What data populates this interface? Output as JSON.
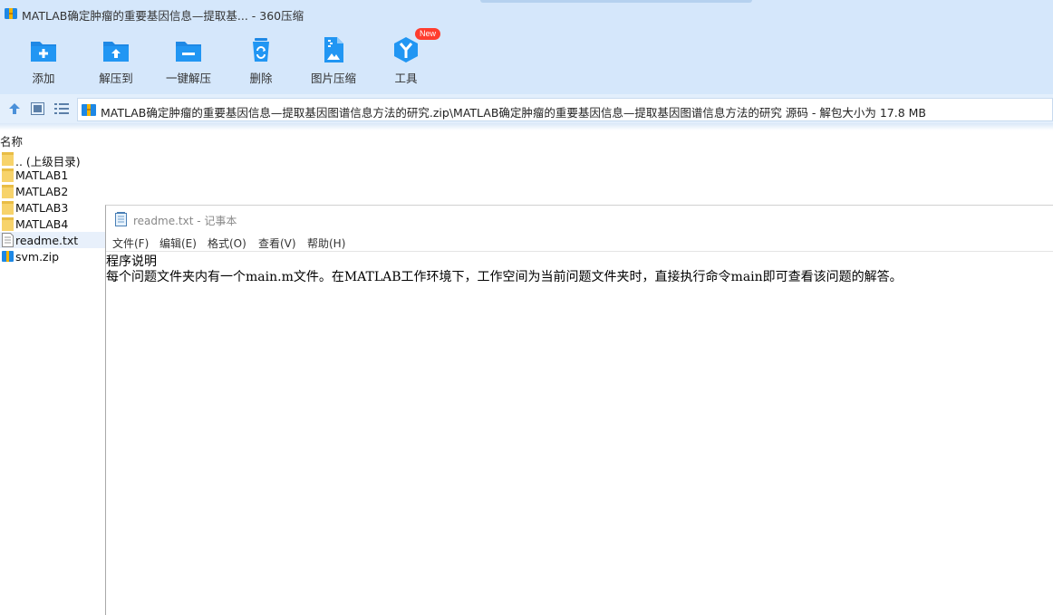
{
  "window": {
    "title": "MATLAB确定肿瘤的重要基因信息—提取基... - 360压缩"
  },
  "toolbar": {
    "items": [
      {
        "label": "添加",
        "icon": "add-icon"
      },
      {
        "label": "解压到",
        "icon": "extract-to-icon"
      },
      {
        "label": "一键解压",
        "icon": "one-click-extract-icon"
      },
      {
        "label": "删除",
        "icon": "delete-icon"
      },
      {
        "label": "图片压缩",
        "icon": "image-compress-icon"
      },
      {
        "label": "工具",
        "icon": "tools-icon",
        "badge": "New"
      }
    ]
  },
  "address": {
    "path": "MATLAB确定肿瘤的重要基因信息—提取基因图谱信息方法的研究.zip\\MATLAB确定肿瘤的重要基因信息—提取基因图谱信息方法的研究 源码 - 解包大小为 17.8 MB"
  },
  "filelist": {
    "column_name": "名称",
    "items": [
      {
        "name": ".. (上级目录)",
        "type": "folder"
      },
      {
        "name": "MATLAB1",
        "type": "folder"
      },
      {
        "name": "MATLAB2",
        "type": "folder"
      },
      {
        "name": "MATLAB3",
        "type": "folder"
      },
      {
        "name": "MATLAB4",
        "type": "folder"
      },
      {
        "name": "readme.txt",
        "type": "text"
      },
      {
        "name": "svm.zip",
        "type": "zip"
      }
    ]
  },
  "notepad": {
    "title": "readme.txt - 记事本",
    "menu": [
      "文件(F)",
      "编辑(E)",
      "格式(O)",
      "查看(V)",
      "帮助(H)"
    ],
    "lines": [
      "程序说明",
      "每个问题文件夹内有一个main.m文件。在MATLAB工作环境下，工作空间为当前问题文件夹时，直接执行命令main即可查看该问题的解答。"
    ]
  },
  "colors": {
    "toolbar_bg": "#d5e7fb",
    "icon_blue": "#1e88e5",
    "badge_red": "#ff3d2e",
    "folder_yellow": "#f7d36b"
  }
}
